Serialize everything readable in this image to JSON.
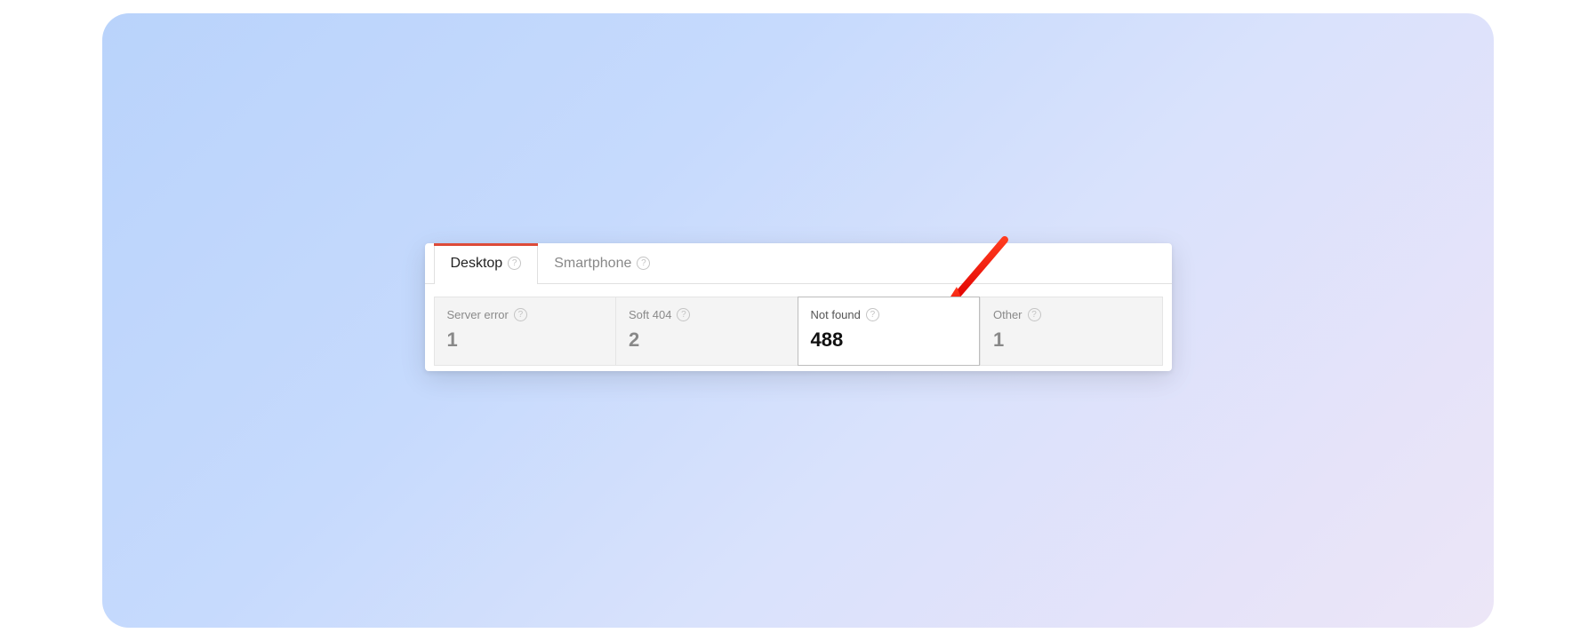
{
  "tabs": [
    {
      "label": "Desktop",
      "active": true
    },
    {
      "label": "Smartphone",
      "active": false
    }
  ],
  "cards": [
    {
      "label": "Server error",
      "value": "1",
      "selected": false
    },
    {
      "label": "Soft 404",
      "value": "2",
      "selected": false
    },
    {
      "label": "Not found",
      "value": "488",
      "selected": true
    },
    {
      "label": "Other",
      "value": "1",
      "selected": false
    }
  ],
  "accent_color": "#dd4b39",
  "arrow_color": "#ff1a00"
}
